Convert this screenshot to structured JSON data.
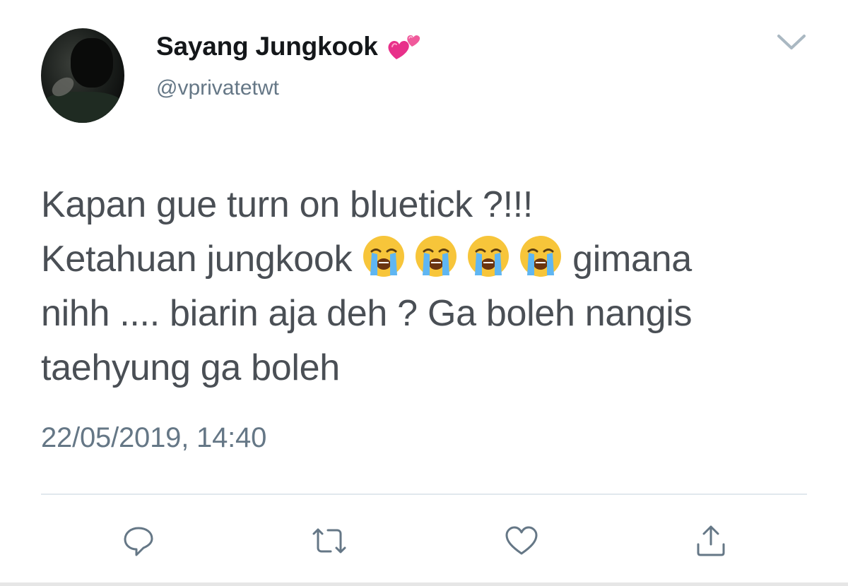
{
  "user": {
    "display_name": "Sayang Jungkook",
    "name_emoji": "two-hearts",
    "handle": "@vprivatetwt"
  },
  "tweet": {
    "line1": "Kapan gue turn on bluetick ?!!!",
    "line2_before": "Ketahuan jungkook",
    "line2_emoji": [
      "loudly-crying-face",
      "loudly-crying-face",
      "loudly-crying-face",
      "loudly-crying-face"
    ],
    "line2_after": "gimana",
    "line3": "nihh .... biarin aja deh ? Ga boleh nangis",
    "line4": "taehyung ga boleh",
    "timestamp": "22/05/2019, 14:40"
  },
  "actions": {
    "icons": [
      "reply-icon",
      "retweet-icon",
      "like-icon",
      "share-icon"
    ]
  },
  "colors": {
    "text_primary": "#14171a",
    "text_secondary": "#657786",
    "tweet_text": "#4a4f55",
    "icon": "#657786",
    "divider": "#e1e8ed",
    "heart_pink": "#f05a9b"
  }
}
